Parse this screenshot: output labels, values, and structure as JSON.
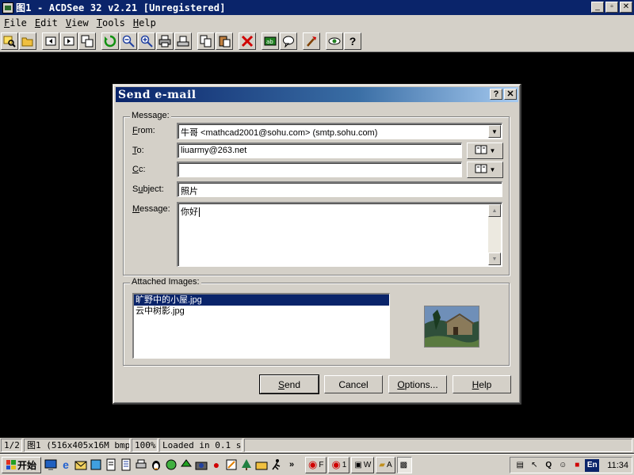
{
  "window": {
    "title": "图1 - ACDSee 32 v2.21 [Unregistered]",
    "min": "_",
    "max": "▫",
    "close": "✕"
  },
  "menu": [
    {
      "key": "F",
      "rest": "ile"
    },
    {
      "key": "E",
      "rest": "dit"
    },
    {
      "key": "V",
      "rest": "iew"
    },
    {
      "key": "T",
      "rest": "ools"
    },
    {
      "key": "H",
      "rest": "elp"
    }
  ],
  "toolbar_icons": [
    "browse-icon",
    "open-folder-icon",
    "sep",
    "prev-icon",
    "next-icon",
    "copy-window-icon",
    "sep",
    "rotate-icon",
    "zoom-out-icon",
    "zoom-in-icon",
    "print-icon",
    "scan-icon",
    "sep",
    "copy-icon",
    "paste-icon",
    "sep",
    "delete-icon",
    "sep",
    "rename-icon",
    "comment-icon",
    "sep",
    "tools-icon",
    "sep",
    "eye-icon",
    "help-icon"
  ],
  "dialog": {
    "title": "Send e-mail",
    "help_btn": "?",
    "close_btn": "✕",
    "message_group": "Message:",
    "from_key": "F",
    "from_rest": "rom:",
    "from_value": "牛哥 <mathcad2001@sohu.com> (smtp.sohu.com)",
    "to_key": "T",
    "to_rest": "o:",
    "to_value": "liuarmy@263.net",
    "cc_key": "C",
    "cc_rest": "c:",
    "cc_value": "",
    "subject_pre": "S",
    "subject_key": "u",
    "subject_rest": "bject:",
    "subject_value": "照片",
    "message_key": "M",
    "message_rest": "essage:",
    "message_value": "你好",
    "attached_group": "Attached Images:",
    "attachments": [
      "旷野中的小屋.jpg",
      "云中树影.jpg"
    ],
    "send_key": "S",
    "send_rest": "end",
    "cancel": "Cancel",
    "options_key": "O",
    "options_rest": "ptions...",
    "help_key": "H",
    "help_rest": "elp"
  },
  "status": {
    "page": "1/2",
    "file": "图1 (516x405x16M bmp)",
    "zoom": "100%",
    "loaded": "Loaded in 0.1 s"
  },
  "taskbar": {
    "start": "开始",
    "tasks": [
      "F",
      "1",
      "W",
      "A",
      ""
    ],
    "lang": "En",
    "clock": "11:34",
    "more": "»"
  },
  "colors": {
    "titlebar": "#0a246a",
    "face": "#d4d0c8",
    "selection": "#0a246a"
  }
}
